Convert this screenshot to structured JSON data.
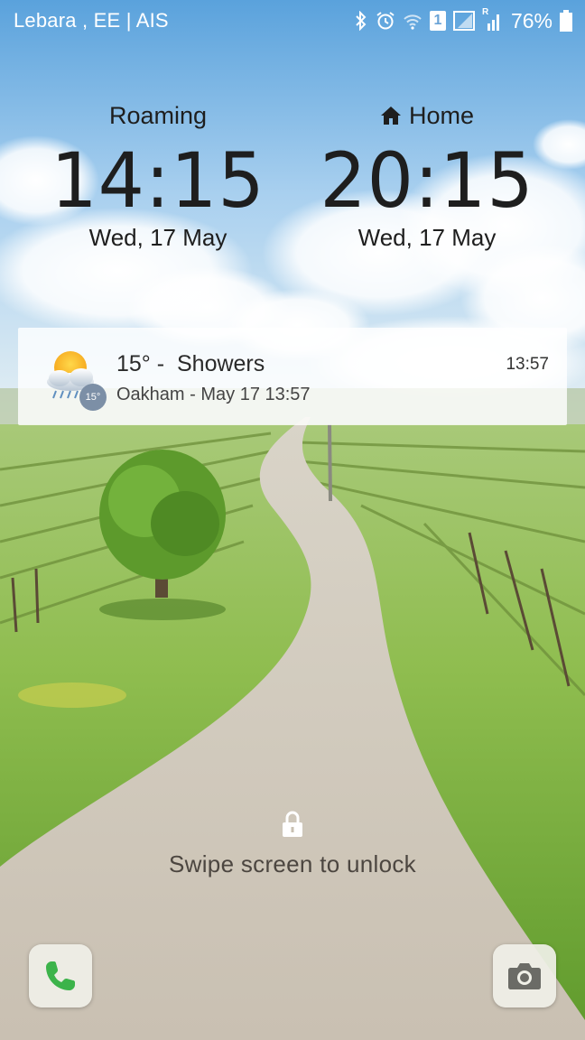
{
  "status_bar": {
    "carrier": "Lebara , EE | AIS",
    "battery": "76%",
    "sim_slot": "1",
    "roaming_indicator": "R",
    "icons": [
      "bluetooth-icon",
      "alarm-icon",
      "wifi-icon",
      "sim-1-icon",
      "signal-icon",
      "roaming-signal-icon",
      "battery-icon"
    ]
  },
  "clocks": {
    "roaming": {
      "label": "Roaming",
      "time": "14:15",
      "date": "Wed, 17 May"
    },
    "home": {
      "label": "Home",
      "time": "20:15",
      "date": "Wed, 17 May",
      "icon": "home-icon"
    }
  },
  "weather": {
    "temperature": "15°",
    "separator": " -  ",
    "condition": "Showers",
    "location_line": "Oakham - May 17  13:57",
    "updated_time": "13:57",
    "badge": "15°",
    "icon": "sun-cloud-rain-icon"
  },
  "unlock": {
    "hint": "Swipe screen to unlock",
    "icon": "lock-icon"
  },
  "shortcuts": {
    "phone_icon": "phone-icon",
    "camera_icon": "camera-icon"
  },
  "colors": {
    "phone_green": "#3cb34a",
    "camera_gray": "#6b6b66"
  }
}
